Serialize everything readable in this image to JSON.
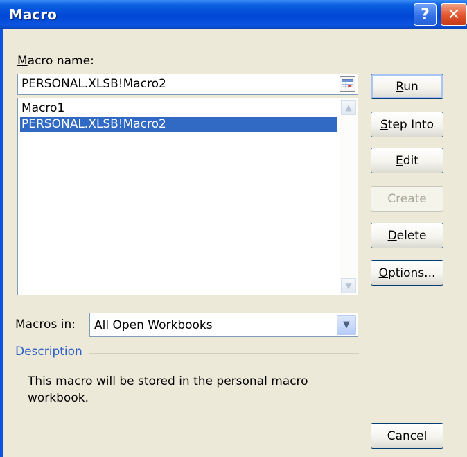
{
  "window": {
    "title": "Macro",
    "help_glyph": "?",
    "close_glyph": "✕"
  },
  "macro_name": {
    "label_accel": "M",
    "label_rest": "acro name:",
    "value": "PERSONAL.XLSB!Macro2"
  },
  "macro_list": {
    "items": [
      "Macro1",
      "PERSONAL.XLSB!Macro2"
    ],
    "selected_index": 1
  },
  "macros_in": {
    "label_pre": "M",
    "label_accel": "a",
    "label_rest": "cros in:",
    "value": "All Open Workbooks"
  },
  "description": {
    "title": "Description",
    "text": "This macro will be stored in the personal macro workbook."
  },
  "buttons": {
    "run": {
      "accel": "R",
      "rest": "un"
    },
    "step_into": {
      "accel": "S",
      "rest": "tep Into"
    },
    "edit": {
      "accel": "E",
      "rest": "dit"
    },
    "create": {
      "label": "Create"
    },
    "delete": {
      "accel": "D",
      "rest": "elete"
    },
    "options": {
      "accel": "O",
      "rest": "ptions..."
    },
    "cancel": {
      "label": "Cancel"
    }
  },
  "colors": {
    "titlebar": "#0046d5",
    "selection": "#316ac5",
    "description_title": "#2d5fc8",
    "dialog_bg": "#ece9d8"
  }
}
